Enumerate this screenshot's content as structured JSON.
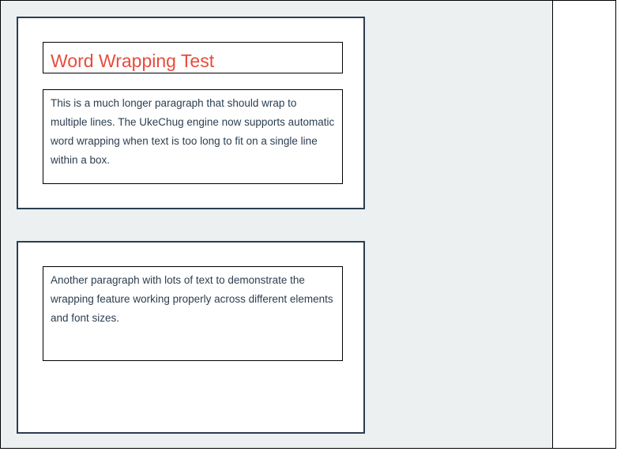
{
  "colors": {
    "background": "#ecf0f1",
    "card_border": "#2c3e50",
    "title": "#e74c3c",
    "text": "#2c3e50"
  },
  "card_1": {
    "title": "Word Wrapping Test",
    "paragraph": "This is a much longer paragraph that should wrap to multiple lines. The UkeChug engine now supports automatic word wrapping when text is too long to fit on a single line within a box."
  },
  "card_2": {
    "paragraph": "Another paragraph with lots of text to demonstrate the wrapping feature working properly across different elements and font sizes."
  }
}
